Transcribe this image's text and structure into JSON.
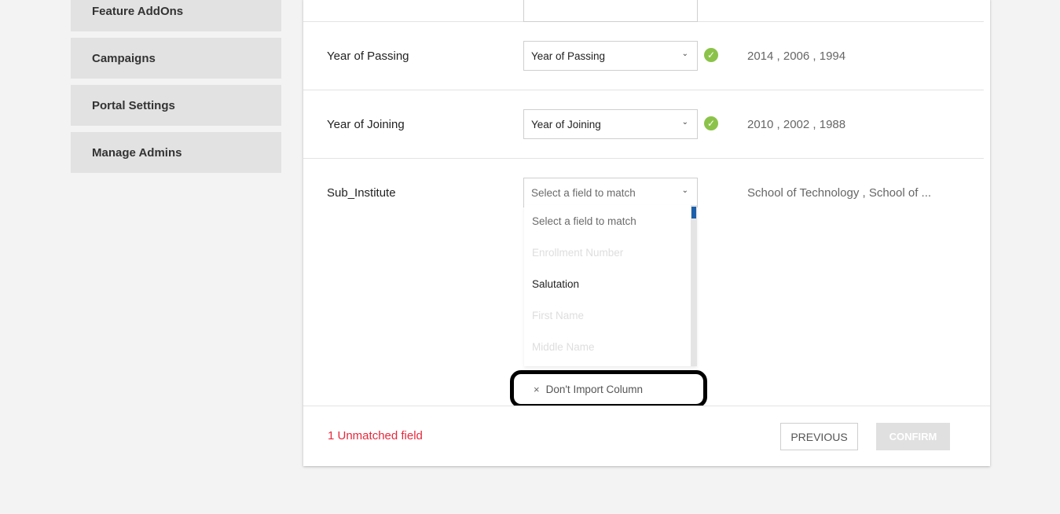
{
  "sidebar": {
    "items": [
      {
        "label": "Feature AddOns"
      },
      {
        "label": "Campaigns"
      },
      {
        "label": "Portal Settings"
      },
      {
        "label": "Manage Admins"
      }
    ]
  },
  "rows": [
    {
      "label": "Year of Passing",
      "selected": "Year of Passing",
      "matched": true,
      "sample": "2014 , 2006 , 1994"
    },
    {
      "label": "Year of Joining",
      "selected": "Year of Joining",
      "matched": true,
      "sample": "2010 , 2002 , 1988"
    },
    {
      "label": "Sub_Institute",
      "selected": "Select a field to match",
      "matched": false,
      "sample": "School of Technology , School of ..."
    }
  ],
  "dropdown": {
    "options": [
      {
        "label": "Select a field to match",
        "state": "placeholder"
      },
      {
        "label": "Enrollment Number",
        "state": "disabled"
      },
      {
        "label": "Salutation",
        "state": "enabled"
      },
      {
        "label": "First Name",
        "state": "disabled"
      },
      {
        "label": "Middle Name",
        "state": "disabled"
      }
    ],
    "dont_import": "Don't Import Column",
    "dont_import_icon": "×"
  },
  "footer": {
    "unmatched": "1 Unmatched field",
    "previous": "PREVIOUS",
    "confirm": "CONFIRM"
  },
  "icons": {
    "chevron": "⌄",
    "check": "✓"
  },
  "colors": {
    "accent": "#1b5fab",
    "success": "#8bc34a",
    "error": "#e8283c"
  }
}
